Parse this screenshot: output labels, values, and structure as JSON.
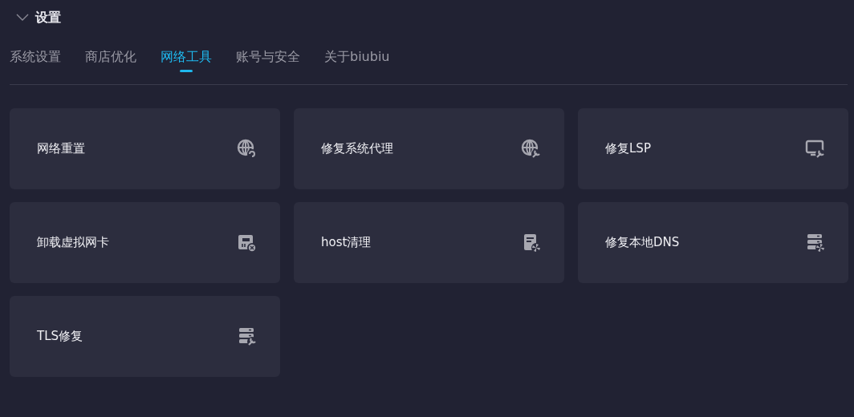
{
  "section": {
    "title": "设置",
    "expanded": true
  },
  "tabs": [
    {
      "label": "系统设置",
      "selected": false
    },
    {
      "label": "商店优化",
      "selected": false
    },
    {
      "label": "网络工具",
      "selected": true
    },
    {
      "label": "账号与安全",
      "selected": false
    },
    {
      "label": "关于biubiu",
      "selected": false
    }
  ],
  "tools": [
    {
      "label": "网络重置"
    },
    {
      "label": "修复系统代理"
    },
    {
      "label": "修复LSP"
    },
    {
      "label": "卸载虚拟网卡"
    },
    {
      "label": "host清理"
    },
    {
      "label": "修复本地DNS"
    },
    {
      "label": "TLS修复"
    }
  ]
}
